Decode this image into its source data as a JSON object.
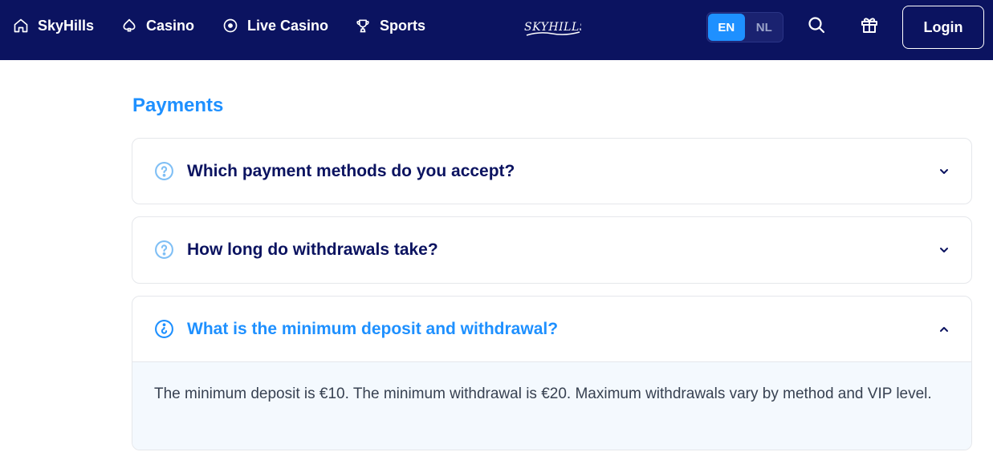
{
  "header": {
    "nav": [
      {
        "label": "SkyHills",
        "icon": "home-icon"
      },
      {
        "label": "Casino",
        "icon": "spade-icon"
      },
      {
        "label": "Live Casino",
        "icon": "live-dot-icon"
      },
      {
        "label": "Sports",
        "icon": "trophy-icon"
      }
    ],
    "logo_text": "SKYHILLS",
    "languages": [
      {
        "code": "EN",
        "active": true
      },
      {
        "code": "NL",
        "active": false
      }
    ],
    "login_label": "Login"
  },
  "main": {
    "section_title": "Payments",
    "faqs": [
      {
        "question": "Which payment methods do you accept?",
        "open": false,
        "icon": "question-circle-icon"
      },
      {
        "question": "How long do withdrawals take?",
        "open": false,
        "icon": "question-circle-icon"
      },
      {
        "question": "What is the minimum deposit and withdrawal?",
        "open": true,
        "icon": "question-circle-icon",
        "answer": "The minimum deposit is €10. The minimum withdrawal is €20. Maximum withdrawals vary by method and VIP level."
      }
    ]
  },
  "colors": {
    "header_bg": "#0b1360",
    "accent": "#1e90ff",
    "question_text": "#0b1360"
  }
}
